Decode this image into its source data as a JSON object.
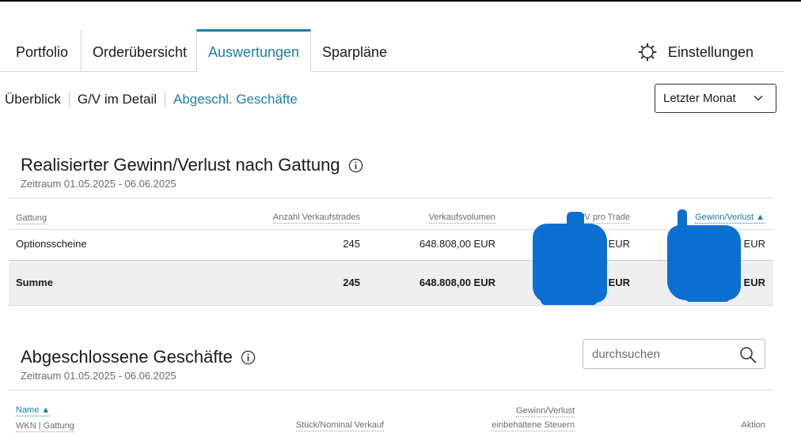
{
  "main_tabs": [
    "Portfolio",
    "Orderübersicht",
    "Auswertungen",
    "Sparpläne"
  ],
  "settings_label": "Einstellungen",
  "subnav": [
    "Überblick",
    "G/V im Detail",
    "Abgeschl. Geschäfte"
  ],
  "period_select": {
    "selected": "Letzter Monat"
  },
  "section1": {
    "title": "Realisierter Gewinn/Verlust nach Gattung",
    "period": "Zeitraum 01.05.2025 - 06.06.2025",
    "headers": [
      "Gattung",
      "Anzahl Verkaufstrades",
      "Verkaufsvolumen",
      "G/V pro Trade",
      "Gewinn/Verlust"
    ],
    "rows": [
      {
        "gattung": "Optionsscheine",
        "anzahl": "245",
        "volumen": "648.808,00 EUR",
        "gv_trade_suffix": "EUR",
        "gv_suffix": "EUR"
      }
    ],
    "sum": {
      "label": "Summe",
      "anzahl": "245",
      "volumen": "648.808,00 EUR",
      "gv_trade_suffix": "EUR",
      "gv_suffix": "EUR"
    }
  },
  "section2": {
    "title": "Abgeschlossene Geschäfte",
    "period": "Zeitraum 01.05.2025 - 06.06.2025",
    "search_placeholder": "durchsuchen",
    "headers": {
      "name": "Name",
      "wkn": "WKN | Gattung",
      "stueck": "Stück/Nominal Verkauf",
      "gv": "Gewinn/Verlust",
      "steuern": "einbehaltene Steuern",
      "aktion": "Aktion"
    }
  },
  "colors": {
    "accent": "#1a7fa6",
    "redaction": "#0b6fd2"
  }
}
